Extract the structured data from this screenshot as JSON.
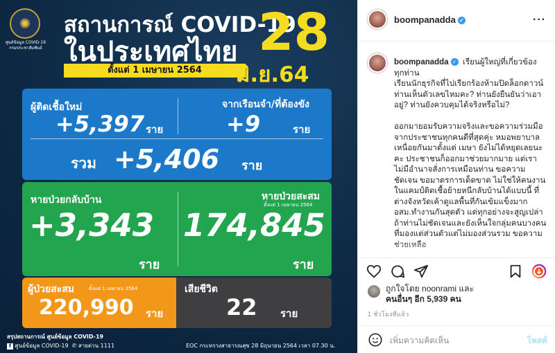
{
  "infographic": {
    "seal_caption": "ศูนย์ข้อมูล\nCOVID-19\nกรมประชาสัมพันธ์",
    "headline_line1": "สถานการณ์ COVID-19",
    "headline_line2": "ในประเทศไทย",
    "since_label": "ตั้งแต่ 1 เมษายน 2564",
    "date_day": "28",
    "date_month_year": "มิ.ย.64",
    "new_cases": {
      "label": "ผู้ติดเชื้อใหม่",
      "value": "+5,397",
      "unit": "ราย"
    },
    "prison_cases": {
      "label": "จากเรือนจำ/ที่ต้องขัง",
      "value": "+9",
      "unit": "ราย"
    },
    "total_today": {
      "label": "รวม",
      "value": "+5,406",
      "unit": "ราย"
    },
    "recovered_today": {
      "label": "หายป่วยกลับบ้าน",
      "value": "+3,343",
      "unit": "ราย"
    },
    "recovered_total": {
      "label": "หายป่วยสะสม",
      "sublabel": "ตั้งแต่ 1 เมษายน 2564",
      "value": "174,845",
      "unit": "ราย"
    },
    "cumulative_cases": {
      "label": "ผู้ป่วยสะสม",
      "sublabel": "ตั้งแต่ 1 เมษายน 2564",
      "value": "220,990",
      "unit": "ราย"
    },
    "deaths": {
      "label": "เสียชีวิต",
      "value": "22",
      "unit": "ราย"
    },
    "footer_title": "สรุปสถานการณ์ ศูนย์ข้อมูล COVID-19",
    "footer_facebook": "ศูนย์ข้อมูล COVID-19",
    "footer_hotline": "สายด่วน 1111",
    "footer_source": "EOC กระทรวงสาธารณสุข 28 มิถุนายน 2564 เวลา 07.30 น."
  },
  "instagram": {
    "username": "boompanadda",
    "verified": true,
    "more_icon": "more-horizontal-icon",
    "caption": "เรียนผู้ใหญ่ที่เกี่ยวข้องทุกท่าน\nเรียนนักธุรกิจที่ไปเรียกร้องห้ามปิดล็อกดาวน์ ท่านเห็นตัวเลขไหมคะ? ท่านยังยืนยันว่าเอาอยู่? ท่านยังควบคุมได้จริงหรือไม่?\n\nออกมายอมรับความจริงและขอความร่วมมือจากประชาชนทุกคนดีที่สุดคุ่ะ หมอพยาบาลเหนื่อยกันมาตั้งแต่ เมษา ยังไม่ได้หยุดเลยนะคะ ประชาชนก็ออกมาช่วยมากมาย แต่เราไม่มีอำนาจสั่งการเหมือนท่าน ขอความชัดเจน ขอมาตรการเด็ดขาด ไม่ใช่ให้คนงานในแคมป์ติดเชื้อย้ายหนีกลับบ้านได้แบบนี้ ที่ต่างจังหวัดเค้าดูแลพื้นที่กันเข้มแข็งมาก อสม.ทำงานกันสุดตัว แต่ทุกอย่างจะสูญเปล่า ถ้าท่านไม่ชัดเจนและยังเห็นใจกลุ่มคนบางคน ที่มองแต่ส่วนตัวแต่ไม่มองส่วนรวม ขอความช่วยเหลือ",
    "actions": {
      "like_icon": "heart-icon",
      "comment_icon": "comment-icon",
      "share_icon": "share-icon",
      "save_icon": "bookmark-icon",
      "story_icon": "story-ring-icon"
    },
    "likes_line1": "ถูกใจโดย noonrami และ",
    "likes_line2": "คนอื่นๆ อีก 5,939 คน",
    "time_ago": "1 ชั่วโมงที่แล้ว",
    "comment_placeholder": "เพิ่มความคิดเห็น",
    "post_label": "โพสต์",
    "colors": {
      "accent": "#3897f0",
      "post_disabled": "#b2dffc",
      "yellow": "#f5dc21",
      "blue_panel": "#1c79c9",
      "green_panel": "#23a44e",
      "orange_panel": "#f2971a",
      "gray_panel": "#3f3f42"
    }
  }
}
